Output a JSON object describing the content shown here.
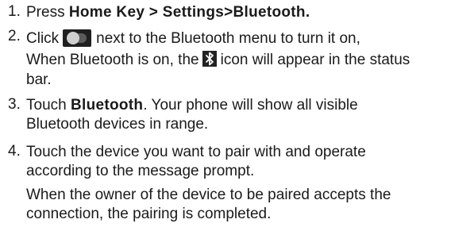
{
  "steps": [
    {
      "number": "1.",
      "prefix": "Press ",
      "bold": "Home Key > Settings>Bluetooth."
    },
    {
      "number": "2.",
      "line1_prefix": "Click",
      "line1_suffix": "next to the Bluetooth menu to turn it on,",
      "line2_prefix": "When Bluetooth is on, the",
      "line2_suffix": "icon will appear in the status",
      "line3": "bar.",
      "icon1": "toggle-switch-icon",
      "icon2": "bluetooth-icon"
    },
    {
      "number": "3.",
      "prefix": "Touch ",
      "bold": "Bluetooth",
      "suffix": ". Your phone will show all visible",
      "line2": "Bluetooth devices in range."
    },
    {
      "number": "4.",
      "line1": "Touch the device you want to pair with and operate",
      "line2": "according to the message prompt.",
      "line3": "When the owner of the device to be paired accepts the",
      "line4": "connection, the pairing is completed."
    }
  ]
}
